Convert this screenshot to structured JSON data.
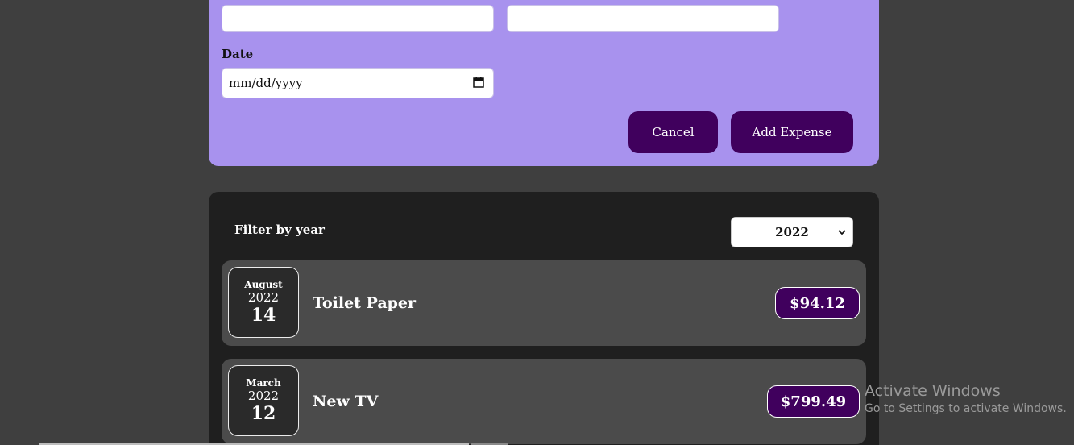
{
  "form": {
    "title_value": "",
    "amount_value": "",
    "date_label": "Date",
    "date_placeholder": "mm/dd/yyyy",
    "cancel_label": "Cancel",
    "add_label": "Add Expense"
  },
  "filter": {
    "label": "Filter by year",
    "selected_year": "2022"
  },
  "expenses": [
    {
      "month": "August",
      "year": "2022",
      "day": "14",
      "title": "Toilet Paper",
      "amount": "$94.12"
    },
    {
      "month": "March",
      "year": "2022",
      "day": "12",
      "title": "New TV",
      "amount": "$799.49"
    }
  ],
  "watermark": {
    "title": "Activate Windows",
    "subtitle": "Go to Settings to activate Windows."
  },
  "colors": {
    "form_background": "#a892ee",
    "button_background": "#40005d",
    "card_background": "#1f1f1f",
    "item_background": "#4b4b4b"
  },
  "icons": {
    "date_picker": "calendar-icon",
    "year_dropdown": "chevron-down-icon"
  }
}
